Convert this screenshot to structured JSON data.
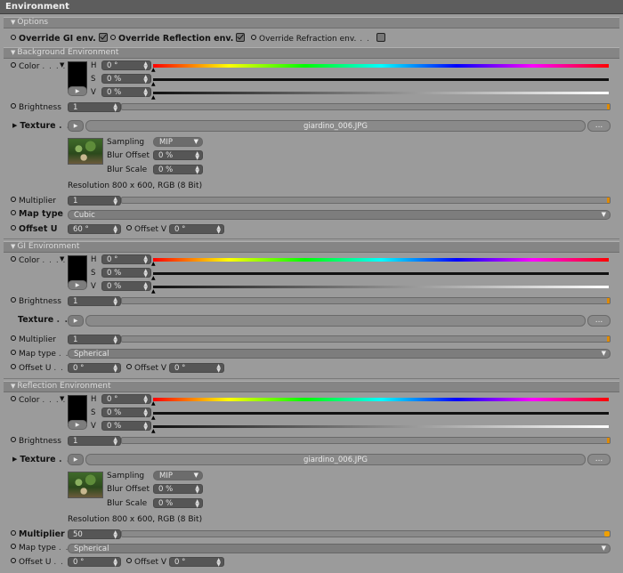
{
  "window": {
    "title": "Environment"
  },
  "options": {
    "header": "Options",
    "override_gi": "Override GI env.",
    "override_gi_checked": true,
    "override_reflection": "Override Reflection env.",
    "override_reflection_checked": true,
    "override_refraction": "Override Refraction env.",
    "override_refraction_checked": false
  },
  "labels": {
    "color": "Color",
    "h": "H",
    "s": "S",
    "v": "V",
    "brightness": "Brightness",
    "texture": "Texture",
    "sampling": "Sampling",
    "blur_offset": "Blur Offset",
    "blur_scale": "Blur Scale",
    "multiplier": "Multiplier",
    "map_type": "Map type",
    "offset_u": "Offset U",
    "offset_v": "Offset V",
    "browse": "...",
    "dots": ". . . ."
  },
  "background": {
    "header": "Background Environment",
    "color_hex": "#000000",
    "h": "0 °",
    "s": "0 %",
    "v": "0 %",
    "brightness": "1",
    "texture_file": "giardino_006.JPG",
    "sampling": "MIP",
    "blur_offset": "0 %",
    "blur_scale": "0 %",
    "resolution": "Resolution 800 x 600, RGB (8 Bit)",
    "multiplier": "1",
    "map_type": "Cubic",
    "offset_u": "60 °",
    "offset_v": "0 °"
  },
  "gi": {
    "header": "GI Environment",
    "color_hex": "#000000",
    "h": "0 °",
    "s": "0 %",
    "v": "0 %",
    "brightness": "1",
    "texture_file": "",
    "multiplier": "1",
    "map_type": "Spherical",
    "offset_u": "0 °",
    "offset_v": "0 °"
  },
  "reflection": {
    "header": "Reflection Environment",
    "color_hex": "#000000",
    "h": "0 °",
    "s": "0 %",
    "v": "0 %",
    "brightness": "1",
    "texture_file": "giardino_006.JPG",
    "sampling": "MIP",
    "blur_offset": "0 %",
    "blur_scale": "0 %",
    "resolution": "Resolution 800 x 600, RGB (8 Bit)",
    "multiplier": "50",
    "map_type": "Spherical",
    "offset_u": "0 °",
    "offset_v": "0 °"
  }
}
